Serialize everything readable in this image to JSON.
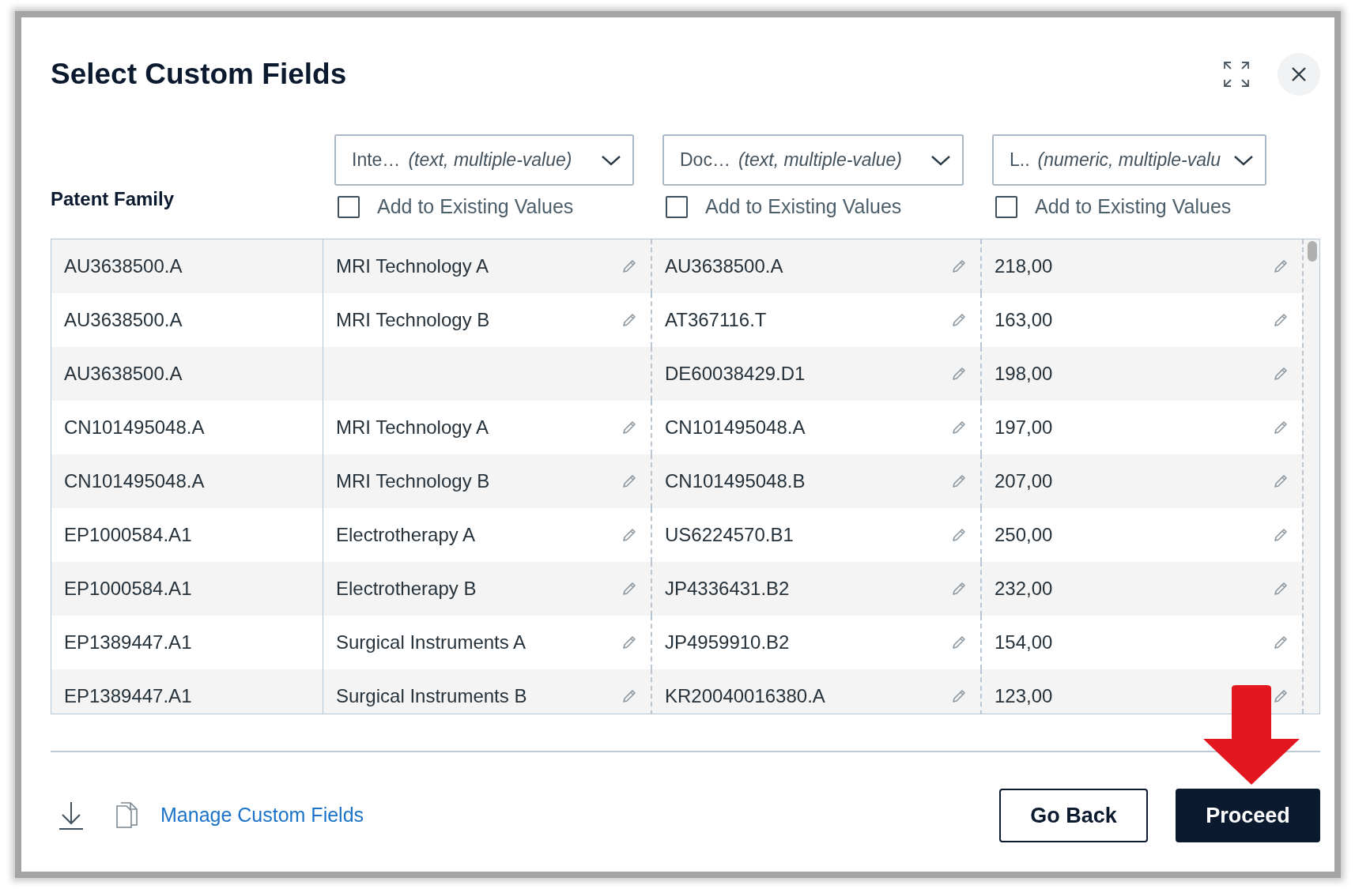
{
  "dialog": {
    "title": "Select Custom Fields"
  },
  "key_column": {
    "label": "Patent Family"
  },
  "field_columns": [
    {
      "name": "Inte…",
      "type": "(text, multiple-value)",
      "add_to_existing": {
        "label": "Add to Existing Values",
        "checked": false
      }
    },
    {
      "name": "Doc…",
      "type": "(text, multiple-value)",
      "add_to_existing": {
        "label": "Add to Existing Values",
        "checked": false
      }
    },
    {
      "name": "L..",
      "type": "(numeric, multiple-valu",
      "add_to_existing": {
        "label": "Add to Existing Values",
        "checked": false
      }
    }
  ],
  "rows": [
    {
      "patent_family": "AU3638500.A",
      "field_1": "MRI Technology A",
      "field_2": "AU3638500.A",
      "field_3": "218,00"
    },
    {
      "patent_family": "AU3638500.A",
      "field_1": "MRI Technology B",
      "field_2": "AT367116.T",
      "field_3": "163,00"
    },
    {
      "patent_family": "AU3638500.A",
      "field_2": "DE60038429.D1",
      "field_3": "198,00"
    },
    {
      "patent_family": "CN101495048.A",
      "field_1": "MRI Technology A",
      "field_2": "CN101495048.A",
      "field_3": "197,00"
    },
    {
      "patent_family": "CN101495048.A",
      "field_1": "MRI Technology B",
      "field_2": "CN101495048.B",
      "field_3": "207,00"
    },
    {
      "patent_family": "EP1000584.A1",
      "field_1": "Electrotherapy A",
      "field_2": "US6224570.B1",
      "field_3": "250,00"
    },
    {
      "patent_family": "EP1000584.A1",
      "field_1": "Electrotherapy B",
      "field_2": "JP4336431.B2",
      "field_3": "232,00"
    },
    {
      "patent_family": "EP1389447.A1",
      "field_1": "Surgical Instruments A",
      "field_2": "JP4959910.B2",
      "field_3": "154,00"
    },
    {
      "patent_family": "EP1389447.A1",
      "field_1": "Surgical Instruments B",
      "field_2": "KR20040016380.A",
      "field_3": "123,00"
    }
  ],
  "footer": {
    "link": "Manage Custom Fields",
    "buttons": [
      {
        "label": "Go Back",
        "kind": "secondary"
      },
      {
        "label": "Proceed",
        "kind": "primary"
      }
    ]
  }
}
